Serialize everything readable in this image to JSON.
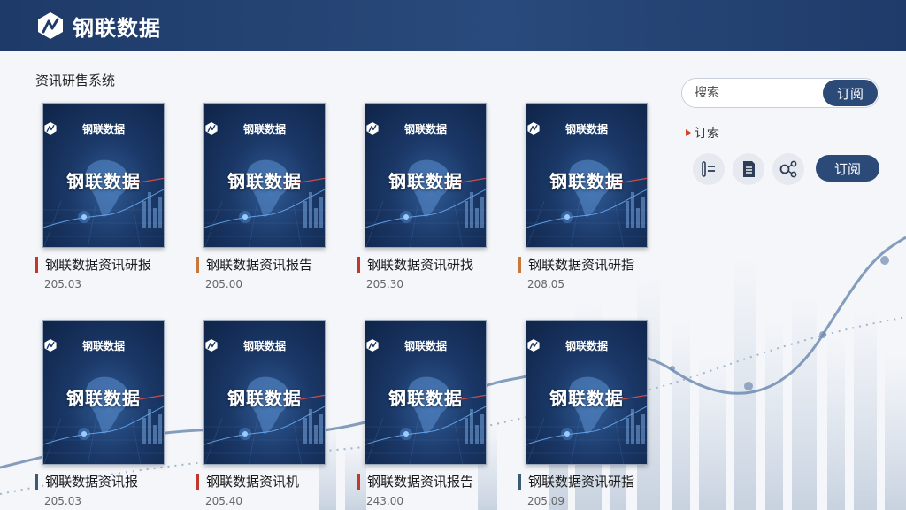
{
  "header": {
    "brand": "钢联数据"
  },
  "section_title": "资讯研售系统",
  "cover": {
    "brand": "钢联数据",
    "title": "钢联数据"
  },
  "cards": [
    {
      "title": "钢联数据资讯研报",
      "date": "205.03",
      "accent": "#c0392b"
    },
    {
      "title": "钢联数据资讯报告",
      "date": "205.00",
      "accent": "#c9783a"
    },
    {
      "title": "钢联数据资讯研找",
      "date": "205.30",
      "accent": "#c0392b"
    },
    {
      "title": "钢联数据资讯研指",
      "date": "208.05",
      "accent": "#c9783a"
    },
    {
      "title": "钢联数据资讯报",
      "date": "205.03",
      "accent": "#3d5a73"
    },
    {
      "title": "钢联数据资讯机",
      "date": "205.40",
      "accent": "#c0392b"
    },
    {
      "title": "钢联数据资讯报告",
      "date": "243.00",
      "accent": "#c0392b"
    },
    {
      "title": "钢联数据资讯研指",
      "date": "205.09",
      "accent": "#3d5a73"
    }
  ],
  "search": {
    "placeholder": "搜索",
    "button": "订阅"
  },
  "subscribe": {
    "label": "订索",
    "button": "订阅"
  },
  "icons": [
    "filter-list-icon",
    "document-icon",
    "share-icon"
  ],
  "colors": {
    "header": "#1e3a68",
    "button": "#2c4a78",
    "accent_red": "#d2452b"
  }
}
